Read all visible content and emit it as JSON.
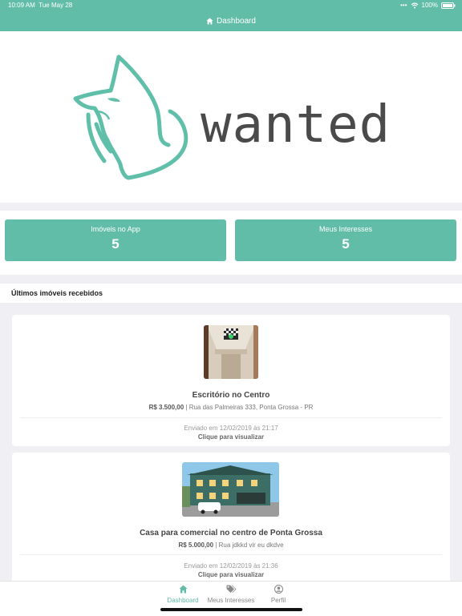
{
  "status": {
    "time": "10:09 AM",
    "date": "Tue May 28",
    "battery": "100%"
  },
  "header": {
    "title": "Dashboard",
    "icon": "home-icon"
  },
  "logo": {
    "text": "wanted"
  },
  "stats": [
    {
      "label": "Imóveis no App",
      "value": "5"
    },
    {
      "label": "Meus Interesses",
      "value": "5"
    }
  ],
  "section": {
    "title": "Últimos imóveis recebidos"
  },
  "properties": [
    {
      "title": "Escritório no Centro",
      "price": "R$ 3.500,00",
      "address": "| Rua das Palmeiras 333, Ponta Grossa - PR",
      "sent": "Enviado em 12/02/2019 às 21:17",
      "link": "Clique para visualizar"
    },
    {
      "title": "Casa para comercial no centro de Ponta Grossa",
      "price": "R$ 5.000,00",
      "address": "| Rua jdkkd vir eu dkdve",
      "sent": "Enviado em 12/02/2019 às 21:36",
      "link": "Clique para visualizar"
    }
  ],
  "tabs": [
    {
      "label": "Dashboard",
      "icon": "home-icon"
    },
    {
      "label": "Meus Interesses",
      "icon": "tags-icon"
    },
    {
      "label": "Perfil",
      "icon": "user-icon"
    }
  ],
  "colors": {
    "accent": "#62bda8",
    "background": "#efeff4"
  }
}
